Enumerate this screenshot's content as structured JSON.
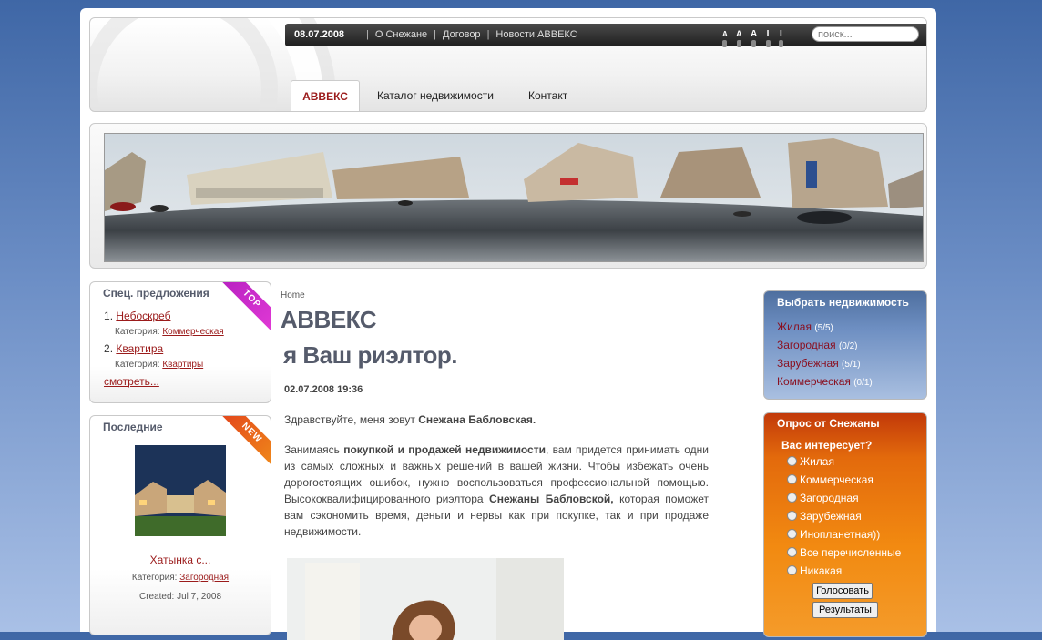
{
  "topbar": {
    "date": "08.07.2008",
    "links": [
      "О Снежане",
      "Договор",
      "Новости АВВЕКС"
    ],
    "font_size_marks": [
      "A",
      "A",
      "A",
      "I",
      "I"
    ],
    "search_placeholder": "поиск..."
  },
  "nav": {
    "tabs": [
      "АВВЕКС",
      "Каталог недвижимости",
      "Контакт"
    ],
    "active_tab": "АВВЕКС"
  },
  "special_offers": {
    "title": "Спец. предложения",
    "ribbon": "TOP",
    "items": [
      {
        "num": "1",
        "title": "Небоскреб",
        "category_label": "Категория:",
        "category": "Коммерческая"
      },
      {
        "num": "2",
        "title": "Квартира",
        "category_label": "Категория:",
        "category": "Квартиры"
      }
    ],
    "more": "смотреть..."
  },
  "latest": {
    "title": "Последние",
    "ribbon": "NEW",
    "item_title": "Хатынка с...",
    "category_label": "Категория:",
    "category": "Загородная",
    "created": "Created: Jul 7, 2008"
  },
  "article": {
    "breadcrumb": "Home",
    "title": "АВВЕКС",
    "subtitle": "я Ваш риэлтор.",
    "datetime": "02.07.2008 19:36",
    "greeting_prefix": "Здравствуйте, меня зовут ",
    "greeting_name": "Снежана Бабловская.",
    "p_part1": "Занимаясь ",
    "p_bold1": "покупкой и продажей недвижимости",
    "p_part2": ", вам придется принимать одни из самых сложных и важных решений в вашей жизни. Чтобы избежать очень дорогостоящих ошибок, нужно воспользоваться профессиональной помощью. Высококвалифицированного риэлтора ",
    "p_bold2": "Снежаны Бабловской,",
    "p_part3": " которая поможет вам сэкономить время, деньги и нервы как при покупке, так и при продаже недвижимости."
  },
  "choose": {
    "title": "Выбрать недвижимость",
    "items": [
      {
        "label": "Жилая",
        "count": "(5/5)"
      },
      {
        "label": "Загородная",
        "count": "(0/2)"
      },
      {
        "label": "Зарубежная",
        "count": "(5/1)"
      },
      {
        "label": "Коммерческая",
        "count": "(0/1)"
      }
    ]
  },
  "poll": {
    "title": "Опрос от Снежаны",
    "question": "Вас интересует?",
    "options": [
      "Жилая",
      "Коммерческая",
      "Загородная",
      "Зарубежная",
      "Инопланетная))",
      "Все перечисленные",
      "Никакая"
    ],
    "vote_button": "Голосовать",
    "results_button": "Результаты"
  },
  "colors": {
    "accent_red": "#9b1b1b",
    "topbar_dark": "#2a2a2a",
    "blue_box": "#6e8fc2",
    "orange_box": "#f28a11"
  }
}
